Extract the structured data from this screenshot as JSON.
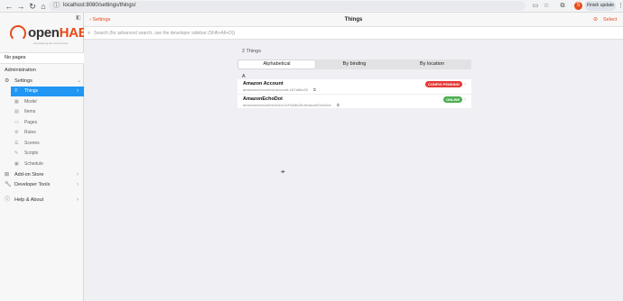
{
  "browser": {
    "url": "localhost:8080/settings/things/",
    "finish_update_label": "Finish update",
    "profile_initial": "S"
  },
  "sidebar": {
    "logo_text_open": "open",
    "logo_text_hab": "HAB",
    "logo_tagline": "empowering the smart home",
    "no_pages": "No pages",
    "section_title": "Administration",
    "settings_label": "Settings",
    "sub_items": [
      {
        "label": "Things",
        "icon": "lightbulb-icon"
      },
      {
        "label": "Model",
        "icon": "model-icon"
      },
      {
        "label": "Items",
        "icon": "items-icon"
      },
      {
        "label": "Pages",
        "icon": "pages-icon"
      },
      {
        "label": "Rules",
        "icon": "rules-icon"
      },
      {
        "label": "Scenes",
        "icon": "scenes-icon"
      },
      {
        "label": "Scripts",
        "icon": "scripts-icon"
      },
      {
        "label": "Schedule",
        "icon": "schedule-icon"
      }
    ],
    "addon_store": "Add-on Store",
    "developer_tools": "Developer Tools",
    "help_about": "Help & About"
  },
  "header": {
    "back_label": "Settings",
    "title": "Things",
    "select_label": "Select"
  },
  "search": {
    "placeholder": "Search (for advanced search, use the developer sidebar (Shift+Alt+D))"
  },
  "main": {
    "count": "2 Things",
    "tabs": [
      "Alphabetical",
      "By binding",
      "By location"
    ],
    "active_tab": 0,
    "group_letter": "A",
    "things": [
      {
        "name": "Amazon Account",
        "uid": "amazonechocontrol:account:11f7a5bc28",
        "status": "CONFIG PENDING",
        "status_color": "#e53935"
      },
      {
        "name": "AmazonEchoDot",
        "uid": "amazonechocontrol:echo:11f7a5bc28:AmazonEchoDot",
        "status": "ONLINE",
        "status_color": "#4caf50"
      }
    ]
  },
  "colors": {
    "accent": "#e64a19",
    "active_nav": "#2196f3"
  }
}
